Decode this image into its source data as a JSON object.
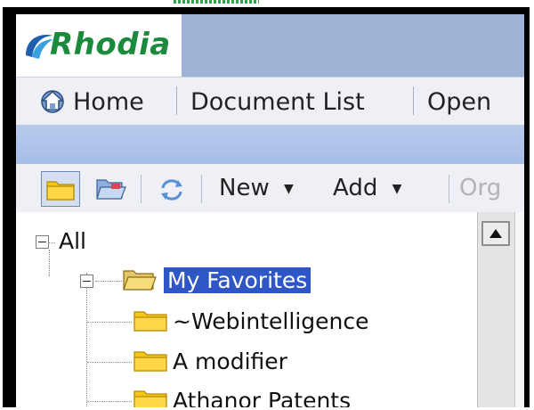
{
  "brand": {
    "logo_text": "Rhodia",
    "colors": {
      "logo_green": "#1a8a3d",
      "logo_blue": "#1e5fb0",
      "header_blue": "#9eb3d6"
    }
  },
  "nav": {
    "home_icon": "home-globe-icon",
    "items": [
      "Home",
      "Document List",
      "Open"
    ]
  },
  "toolbar": {
    "folder_icon": "folder-icon",
    "open_folder_icon": "open-folder-icon",
    "refresh_icon": "refresh-icon",
    "new_label": "New",
    "add_label": "Add",
    "organize_label": "Org"
  },
  "tree": {
    "root_label": "All",
    "favorites_label": "My Favorites",
    "children": [
      "~Webintelligence",
      "A modifier",
      "Athanor Patents"
    ]
  },
  "colors": {
    "selection": "#2f56c6",
    "folder_yellow": "#f5c518"
  }
}
